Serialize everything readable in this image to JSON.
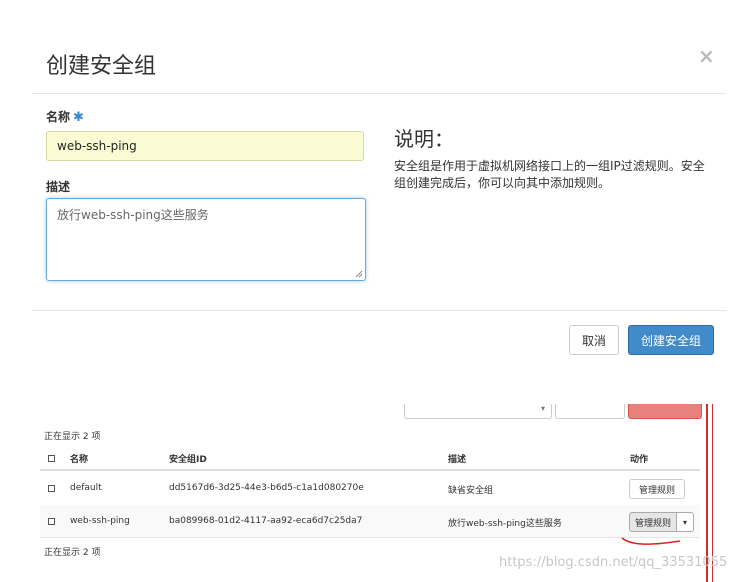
{
  "modal": {
    "title": "创建安全组",
    "close_glyph": "×",
    "name_label": "名称",
    "required_mark": "✱",
    "name_value": "web-ssh-ping",
    "desc_label": "描述",
    "desc_value": "放行web-ssh-ping这些服务",
    "help_title": "说明：",
    "help_text": "安全组是作用于虚拟机网络接口上的一组IP过滤规则。安全组创建完成后，你可以向其中添加规则。",
    "cancel_label": "取消",
    "create_label": "创建安全组"
  },
  "table": {
    "showing_top": "正在显示 2 项",
    "showing_bottom": "正在显示 2 项",
    "headers": {
      "name": "名称",
      "id": "安全组ID",
      "desc": "描述",
      "action": "动作"
    },
    "rows": [
      {
        "name": "default",
        "id": "dd5167d6-3d25-44e3-b6d5-c1a1d080270e",
        "desc": "缺省安全组",
        "action": "管理规则"
      },
      {
        "name": "web-ssh-ping",
        "id": "ba089968-01d2-4117-aa92-eca6d7c25da7",
        "desc": "放行web-ssh-ping这些服务",
        "action": "管理规则"
      }
    ],
    "caret_glyph": "▾"
  },
  "watermark": "https://blog.csdn.net/qq_33531055",
  "colors": {
    "primary": "#428bca",
    "required": "#3a87d1",
    "input_autofill": "#fbfcd4",
    "annotation_red": "#c9302c"
  }
}
